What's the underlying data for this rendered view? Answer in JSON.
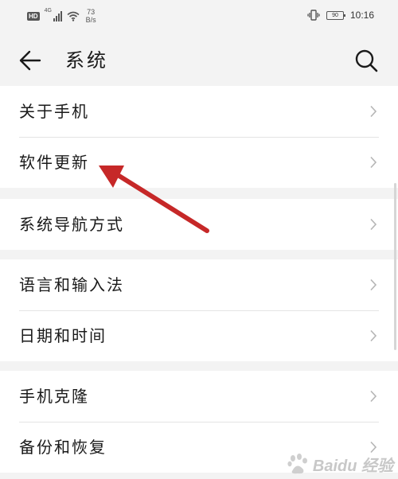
{
  "status_bar": {
    "hd": "HD",
    "network": "4G",
    "speed_value": "73",
    "speed_unit": "B/s",
    "battery": "90",
    "time": "10:16"
  },
  "header": {
    "title": "系统"
  },
  "groups": [
    {
      "items": [
        {
          "label": "关于手机"
        },
        {
          "label": "软件更新"
        }
      ]
    },
    {
      "items": [
        {
          "label": "系统导航方式"
        }
      ]
    },
    {
      "items": [
        {
          "label": "语言和输入法"
        },
        {
          "label": "日期和时间"
        }
      ]
    },
    {
      "items": [
        {
          "label": "手机克隆"
        },
        {
          "label": "备份和恢复"
        }
      ]
    }
  ],
  "watermark": {
    "text": "Baidu 经验"
  },
  "colors": {
    "background": "#f3f3f3",
    "card": "#ffffff",
    "divider": "#e4e4e4",
    "chevron": "#b5b5b5",
    "annotation_arrow": "#c62828"
  },
  "icons": {
    "back": "arrow-left-icon",
    "search": "magnifier-icon",
    "chevron": "chevron-right-icon",
    "vibrate": "vibrate-icon",
    "wifi": "wifi-icon"
  }
}
